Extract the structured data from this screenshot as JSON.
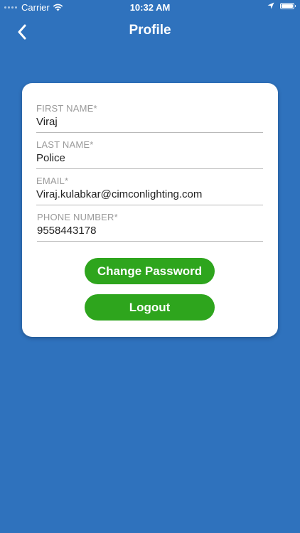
{
  "status_bar": {
    "carrier": "Carrier",
    "time": "10:32 AM",
    "icons": [
      "signal-dots-icon",
      "wifi-icon",
      "location-arrow-icon",
      "battery-icon"
    ]
  },
  "nav": {
    "title": "Profile",
    "back_icon": "chevron-left-icon"
  },
  "form": {
    "first_name": {
      "label": "FIRST NAME*",
      "value": "Viraj"
    },
    "last_name": {
      "label": "LAST NAME*",
      "value": "Police"
    },
    "email": {
      "label": "EMAIL*",
      "value": "Viraj.kulabkar@cimconlighting.com"
    },
    "phone": {
      "label": "PHONE NUMBER*",
      "value": "9558443178"
    }
  },
  "buttons": {
    "change_password": "Change Password",
    "logout": "Logout"
  },
  "colors": {
    "background": "#2f72bd",
    "card": "#ffffff",
    "button": "#2ea51d",
    "label": "#9a9a9a",
    "divider": "#b8b8b8"
  }
}
